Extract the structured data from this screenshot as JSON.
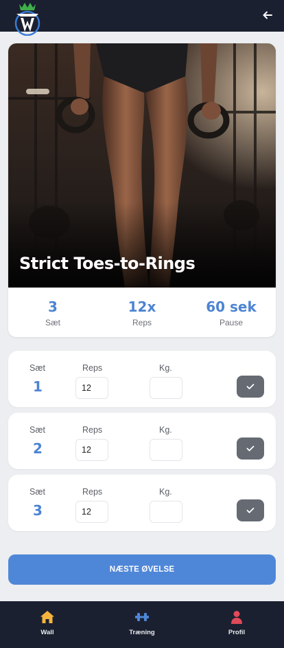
{
  "header": {
    "back_icon": "arrow-left-icon",
    "logo_icon": "brand-logo-icon"
  },
  "exercise": {
    "title": "Strict Toes-to-Rings",
    "stats": [
      {
        "value": "3",
        "label": "Sæt"
      },
      {
        "value": "12x",
        "label": "Reps"
      },
      {
        "value": "60 sek",
        "label": "Pause"
      }
    ]
  },
  "sets": {
    "column_labels": {
      "set": "Sæt",
      "reps": "Reps",
      "kg": "Kg."
    },
    "rows": [
      {
        "number": "1",
        "reps": "12",
        "kg": ""
      },
      {
        "number": "2",
        "reps": "12",
        "kg": ""
      },
      {
        "number": "3",
        "reps": "12",
        "kg": ""
      }
    ]
  },
  "next_button": {
    "label": "NÆSTE ØVELSE"
  },
  "nav": {
    "items": [
      {
        "label": "Wall",
        "icon": "home-icon",
        "color": "#f4b43c"
      },
      {
        "label": "Træning",
        "icon": "dumbbell-icon",
        "color": "#4f87d8"
      },
      {
        "label": "Profil",
        "icon": "user-icon",
        "color": "#e04a5a"
      }
    ]
  },
  "colors": {
    "accent": "#4d84d2",
    "dark": "#1b2030",
    "check": "#656a73"
  }
}
